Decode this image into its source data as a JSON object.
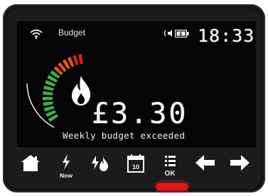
{
  "display": {
    "budget_label": "Budget",
    "time": "18:33",
    "amount": "£3.30",
    "status_message": "Weekly budget exceeded",
    "icons": [
      "wifi-icon",
      "sound-icon",
      "battery-icon",
      "flame-icon"
    ],
    "gauge": {
      "green_segments": 10,
      "orange_segments": 4,
      "red_segments": 2
    }
  },
  "buttons": {
    "home": {
      "icon": "home-icon"
    },
    "now": {
      "icon": "lightning-icon",
      "label": "Now"
    },
    "energy": {
      "icon": "electric-gas-icon"
    },
    "calendar": {
      "icon": "calendar-icon",
      "label": "10"
    },
    "menu": {
      "icon": "menu-list-icon",
      "label": "OK"
    },
    "back": {
      "icon": "arrow-left-icon"
    },
    "forward": {
      "icon": "arrow-right-icon"
    }
  },
  "colors": {
    "gauge_green": "#3fb049",
    "gauge_orange": "#e8521e",
    "gauge_red": "#d81f1f",
    "indicator_red": "#e41919"
  }
}
